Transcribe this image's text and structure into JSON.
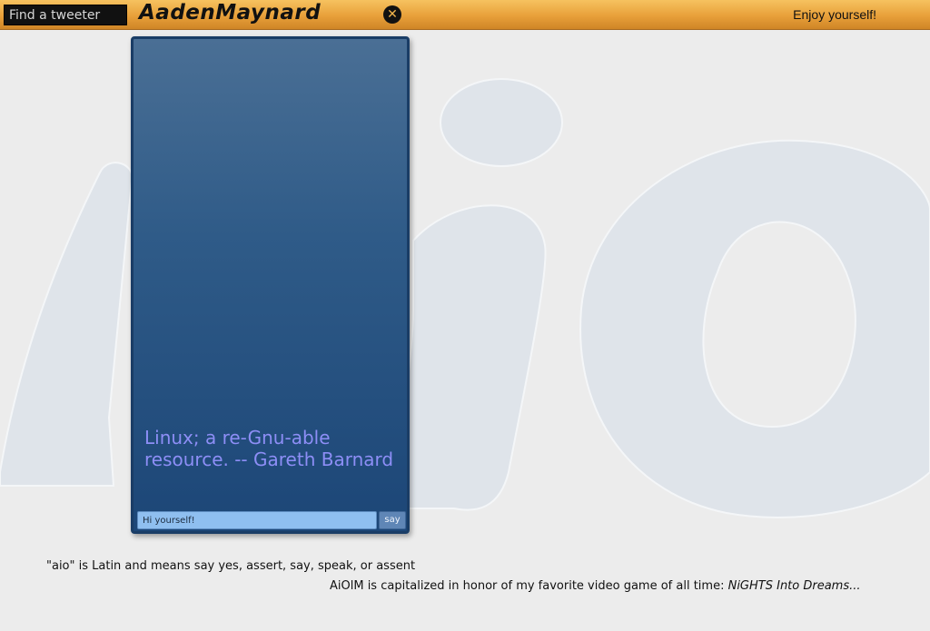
{
  "header": {
    "search_placeholder": "Find a tweeter",
    "username": "AadenMaynard",
    "close_symbol": "✕",
    "tagline": "Enjoy yourself!"
  },
  "watermark_text": "aio",
  "panel": {
    "quote": "Linux; a re-Gnu-able resource. -- Gareth Barnard",
    "say_input_value": "Hi yourself!",
    "say_button_label": "say"
  },
  "footer": {
    "line1": "\"aio\" is Latin and means say yes, assert, say, speak, or assent",
    "line2_prefix": "AiOlM is capitalized in honor of my favorite video game of all time: ",
    "line2_game": "NiGHTS Into Dreams..."
  },
  "colors": {
    "topbar_accent": "#e8a03a",
    "panel_top": "#4a6f95",
    "panel_bottom": "#1c4677",
    "quote_text": "#8d8ef6",
    "watermark_fill": "#dfe4ea"
  },
  "icons": {
    "close": "close-icon"
  }
}
